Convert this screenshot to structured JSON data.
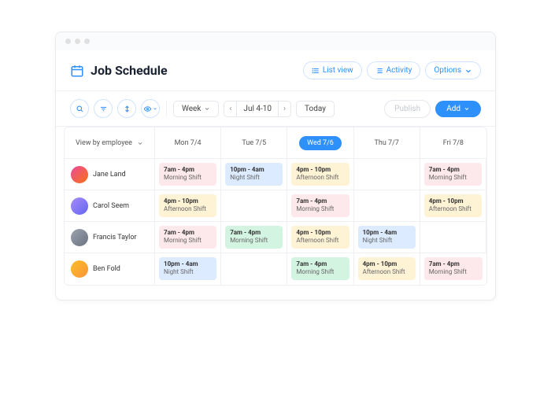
{
  "title": "Job Schedule",
  "header_btns": {
    "list": "List view",
    "activity": "Activity",
    "options": "Options"
  },
  "toolbar": {
    "range": "Week",
    "date": "Jul 4-10",
    "today": "Today",
    "publish": "Publish",
    "add": "Add"
  },
  "view_by": "View by employee",
  "days": [
    "Mon 7/4",
    "Tue 7/5",
    "Wed 7/6",
    "Thu 7/7",
    "Fri 7/8"
  ],
  "active_day_index": 2,
  "shift_types": {
    "morning": {
      "time": "7am - 4pm",
      "name": "Morning Shift",
      "class": "morning"
    },
    "morning-green": {
      "time": "7am - 4pm",
      "name": "Morning Shift",
      "class": "morning-green"
    },
    "afternoon": {
      "time": "4pm - 10pm",
      "name": "Afternoon Shift",
      "class": "afternoon"
    },
    "night": {
      "time": "10pm - 4am",
      "name": "Night Shift",
      "class": "night"
    }
  },
  "employees": [
    {
      "name": "Jane Land",
      "avatar_bg": "linear-gradient(135deg,#ec4899,#f97316)",
      "shifts": [
        "morning",
        "night",
        "afternoon",
        null,
        "morning"
      ]
    },
    {
      "name": "Carol Seem",
      "avatar_bg": "linear-gradient(135deg,#a78bfa,#6366f1)",
      "shifts": [
        "afternoon",
        null,
        "morning",
        null,
        "afternoon"
      ]
    },
    {
      "name": "Francis Taylor",
      "avatar_bg": "linear-gradient(135deg,#9ca3af,#6b7280)",
      "shifts": [
        "morning",
        "morning-green",
        "afternoon",
        "night",
        null
      ]
    },
    {
      "name": "Ben Fold",
      "avatar_bg": "linear-gradient(135deg,#fbbf24,#fb923c)",
      "shifts": [
        "night",
        null,
        "morning-green",
        "afternoon",
        "morning"
      ]
    }
  ]
}
